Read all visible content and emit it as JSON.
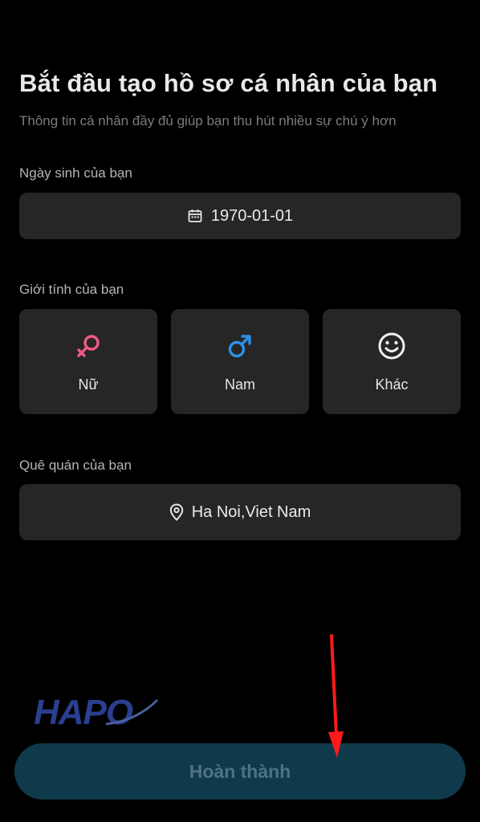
{
  "header": {
    "title": "Bắt đầu tạo hồ sơ cá nhân của bạn",
    "subtitle": "Thông tin cá nhân đầy đủ giúp bạn thu hút nhiều sự chú ý hơn"
  },
  "birthday": {
    "label": "Ngày sinh của bạn",
    "value": "1970-01-01",
    "icon": "calendar-icon"
  },
  "gender": {
    "label": "Giới tính của bạn",
    "options": [
      {
        "label": "Nữ",
        "icon": "female-icon",
        "color": "#f05a84"
      },
      {
        "label": "Nam",
        "icon": "male-icon",
        "color": "#2f8fe8"
      },
      {
        "label": "Khác",
        "icon": "smiley-icon",
        "color": "#f0f0f0"
      }
    ]
  },
  "hometown": {
    "label": "Quê quán của bạn",
    "value": "Ha Noi,Viet Nam",
    "icon": "location-pin-icon"
  },
  "watermark": {
    "text": "HAPO",
    "color": "#2a3f8f"
  },
  "submit": {
    "label": "Hoàn thành",
    "background": "#0f3a4b",
    "text_color": "#4d7384"
  },
  "annotation": {
    "arrow_color": "#ff1a1a"
  }
}
